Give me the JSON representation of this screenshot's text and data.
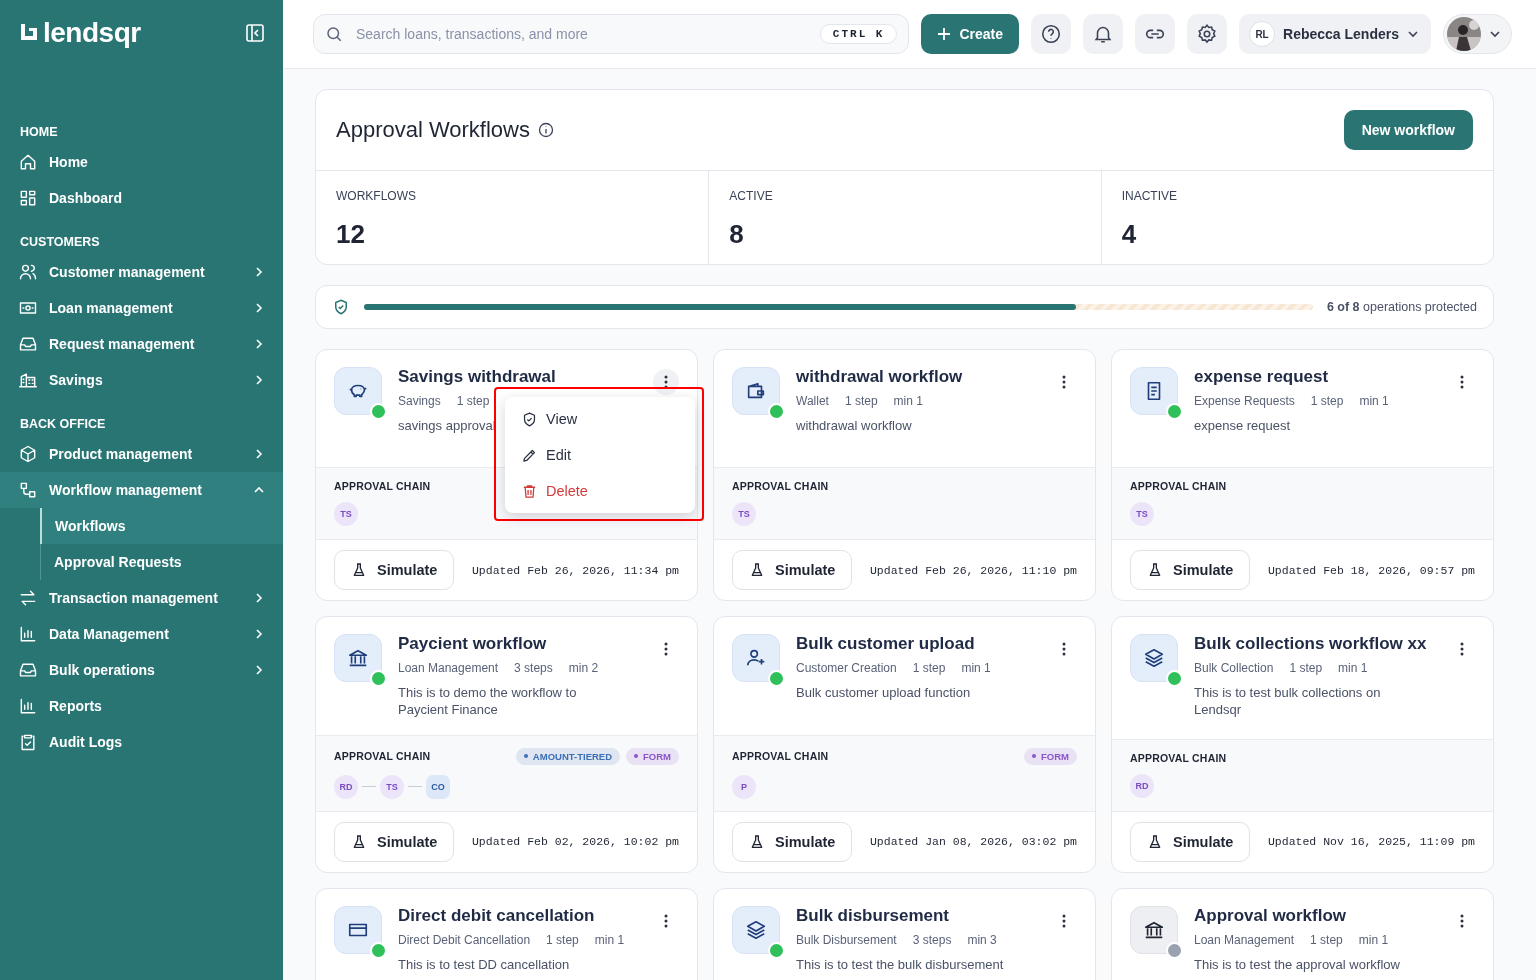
{
  "brand": {
    "name": "lendsqr"
  },
  "sidebar": {
    "sections": [
      {
        "title": "HOME",
        "items": [
          {
            "label": "Home",
            "expandable": false
          },
          {
            "label": "Dashboard",
            "expandable": false
          }
        ]
      },
      {
        "title": "CUSTOMERS",
        "items": [
          {
            "label": "Customer management",
            "expandable": true,
            "expanded": false
          },
          {
            "label": "Loan management",
            "expandable": true,
            "expanded": false
          },
          {
            "label": "Request management",
            "expandable": true,
            "expanded": false
          },
          {
            "label": "Savings",
            "expandable": true,
            "expanded": false
          }
        ]
      },
      {
        "title": "BACK OFFICE",
        "items": [
          {
            "label": "Product management",
            "expandable": true,
            "expanded": false
          },
          {
            "label": "Workflow management",
            "expandable": true,
            "expanded": true,
            "children": [
              {
                "label": "Workflows",
                "selected": true
              },
              {
                "label": "Approval Requests",
                "selected": false
              }
            ]
          },
          {
            "label": "Transaction management",
            "expandable": true,
            "expanded": false
          },
          {
            "label": "Data Management",
            "expandable": true,
            "expanded": false
          },
          {
            "label": "Bulk operations",
            "expandable": true,
            "expanded": false
          },
          {
            "label": "Reports",
            "expandable": false
          },
          {
            "label": "Audit Logs",
            "expandable": false
          }
        ]
      }
    ]
  },
  "topbar": {
    "search": {
      "placeholder": "Search loans, transactions, and more",
      "shortcut": "CTRL K"
    },
    "create_button": "Create",
    "user": {
      "initials": "RL",
      "name": "Rebecca Lenders"
    }
  },
  "page": {
    "title": "Approval Workflows",
    "new_button": "New workflow",
    "stats": [
      {
        "label": "WORKFLOWS",
        "value": "12"
      },
      {
        "label": "ACTIVE",
        "value": "8"
      },
      {
        "label": "INACTIVE",
        "value": "4"
      }
    ],
    "protection": {
      "level": 0.75,
      "text": "**6 of 8** operations protected"
    }
  },
  "cards": [
    {
      "title": "Savings withdrawal",
      "meta": [
        "Savings",
        "1 step"
      ],
      "description": "savings approval",
      "active": true,
      "chain_label": "APPROVAL CHAIN",
      "chain": [
        {
          "initials": "TS",
          "kind": "person"
        }
      ],
      "simulate": "Simulate",
      "updated": "Updated Feb 26, 2026, 11:34 pm",
      "menu": [
        {
          "label": "View",
          "kind": "view"
        },
        {
          "label": "Edit",
          "kind": "edit"
        },
        {
          "label": "Delete",
          "kind": "danger"
        }
      ]
    },
    {
      "title": "withdrawal workflow",
      "meta": [
        "Wallet",
        "1 step",
        "min 1"
      ],
      "description": "withdrawal workflow",
      "active": true,
      "chain_label": "APPROVAL CHAIN",
      "chain": [
        {
          "initials": "TS",
          "kind": "person"
        }
      ],
      "simulate": "Simulate",
      "updated": "Updated Feb 26, 2026, 11:10 pm"
    },
    {
      "title": "expense request",
      "meta": [
        "Expense Requests",
        "1 step",
        "min 1"
      ],
      "description": "expense request",
      "active": true,
      "chain_label": "APPROVAL CHAIN",
      "chain": [
        {
          "initials": "TS",
          "kind": "person"
        }
      ],
      "simulate": "Simulate",
      "updated": "Updated Feb 18, 2026, 09:57 pm"
    },
    {
      "title": "Paycient workflow",
      "meta": [
        "Loan Management",
        "3 steps",
        "min 2"
      ],
      "description": "This is to demo the workflow to Paycient Finance",
      "active": true,
      "chain_label": "APPROVAL CHAIN",
      "chain": [
        {
          "initials": "RD",
          "kind": "person"
        },
        {
          "initials": "TS",
          "kind": "person"
        },
        {
          "initials": "CO",
          "kind": "role"
        }
      ],
      "tags": [
        {
          "label": "AMOUNT-TIERED",
          "color": "#3b6fb6"
        },
        {
          "label": "FORM",
          "color": "#8a55c9"
        }
      ],
      "simulate": "Simulate",
      "updated": "Updated Feb 02, 2026, 10:02 pm"
    },
    {
      "title": "Bulk customer upload",
      "meta": [
        "Customer Creation",
        "1 step",
        "min 1"
      ],
      "description": "Bulk customer upload function",
      "active": true,
      "chain_label": "APPROVAL CHAIN",
      "chain": [
        {
          "initials": "P",
          "kind": "person"
        }
      ],
      "tags": [
        {
          "label": "FORM",
          "color": "#8a55c9"
        }
      ],
      "simulate": "Simulate",
      "updated": "Updated Jan 08, 2026, 03:02 pm"
    },
    {
      "title": "Bulk collections workflow xx",
      "meta": [
        "Bulk Collection",
        "1 step",
        "min 1"
      ],
      "description": "This is to test bulk collections on Lendsqr",
      "active": true,
      "chain_label": "APPROVAL CHAIN",
      "chain": [
        {
          "initials": "RD",
          "kind": "person"
        }
      ],
      "simulate": "Simulate",
      "updated": "Updated Nov 16, 2025, 11:09 pm"
    },
    {
      "title": "Direct debit cancellation",
      "meta": [
        "Direct Debit Cancellation",
        "1 step",
        "min 1"
      ],
      "description": "This is to test DD cancellation",
      "active": true
    },
    {
      "title": "Bulk disbursement",
      "meta": [
        "Bulk Disbursement",
        "3 steps",
        "min 3"
      ],
      "description": "This is to test the bulk disbursement",
      "active": true
    },
    {
      "title": "Approval workflow",
      "meta": [
        "Loan Management",
        "1 step",
        "min 1"
      ],
      "description": "This is to test the approval workflow",
      "active": false
    }
  ]
}
